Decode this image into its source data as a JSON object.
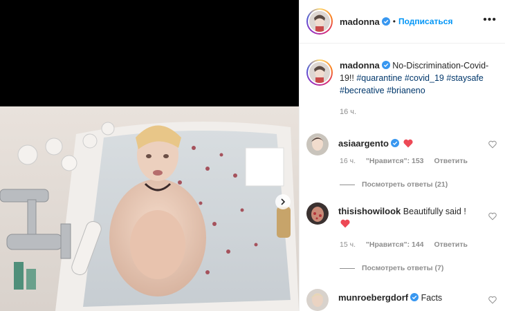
{
  "post": {
    "author": "madonna",
    "follow_label": "Подписаться",
    "dot": "•",
    "more_label": "•••",
    "caption_text": "No-Discrimination-Covid-19!!",
    "hashtags": [
      "#quarantine",
      "#covid_19",
      "#staysafe",
      "#becreative",
      "#brianeno"
    ],
    "time": "16 ч."
  },
  "comments": [
    {
      "user": "asiaargento",
      "text": "",
      "time": "16 ч.",
      "likes": "\"Нравится\": 153",
      "reply": "Ответить",
      "view_replies": "Посмотреть ответы (21)"
    },
    {
      "user": "thisishowilook",
      "text": "Beautifully said !",
      "time": "15 ч.",
      "likes": "\"Нравится\": 144",
      "reply": "Ответить",
      "view_replies": "Посмотреть ответы (7)"
    },
    {
      "user": "munroebergdorf",
      "text": "Facts"
    }
  ],
  "colors": {
    "link_blue": "#0095f6",
    "hashtag": "#00376b",
    "verified": "#3897f0",
    "heart_red": "#ed4956",
    "muted": "#8e8e8e"
  },
  "icons": [
    "verified-badge-icon",
    "chevron-right-icon",
    "heart-outline-icon",
    "red-heart-emoji-icon",
    "more-options-icon"
  ]
}
